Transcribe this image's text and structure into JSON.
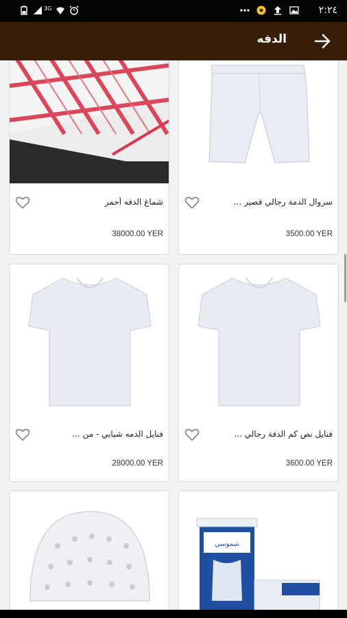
{
  "status_bar": {
    "time": "٢:٢٤",
    "network": "3G"
  },
  "app_bar": {
    "title": "الدفه"
  },
  "products": [
    {
      "name": "سروال الدمة رجالي  قصير ...",
      "price": "3500.00 YER",
      "image": "white-shorts"
    },
    {
      "name": "شماغ الدفه أحمر",
      "price": "38000.00 YER",
      "image": "red-shemagh"
    },
    {
      "name": "فنايل  نص كم الدفة رجالي ...",
      "price": "3600.00 YER",
      "image": "white-tshirt"
    },
    {
      "name": "فنايل الدمه شبابي  - من ...",
      "price": "28000.00 YER",
      "image": "white-tshirt"
    },
    {
      "name": "",
      "price": "",
      "image": "undershirt-box"
    },
    {
      "name": "",
      "price": "",
      "image": "white-kufi-cap"
    }
  ],
  "colors": {
    "app_bar": "#3a1f08",
    "status_bar": "#050505",
    "card_bg": "#ffffff",
    "page_bg": "#f2f2f2"
  }
}
